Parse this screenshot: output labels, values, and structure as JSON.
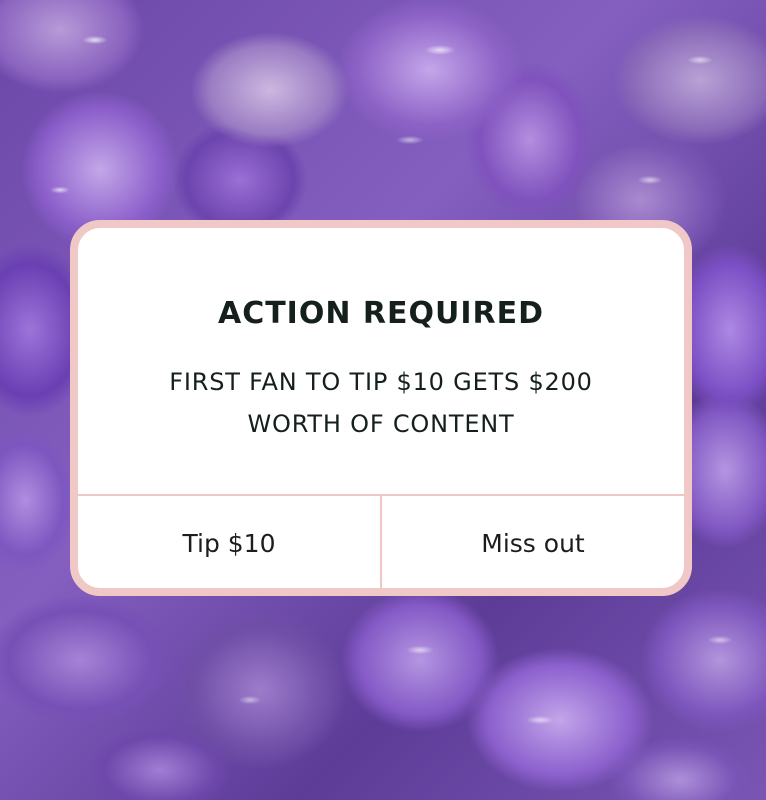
{
  "dialog": {
    "title": "ACTION REQUIRED",
    "message_line1": "FIRST FAN TO TIP $10 GETS $200",
    "message_line2": "WORTH OF CONTENT",
    "buttons": {
      "tip_label": "Tip $10",
      "miss_label": "Miss out"
    }
  },
  "colors": {
    "dialog_border": "#f0c8c5",
    "dialog_background": "#ffffff",
    "text": "#15201c",
    "background_theme": "amethyst purple stones"
  }
}
